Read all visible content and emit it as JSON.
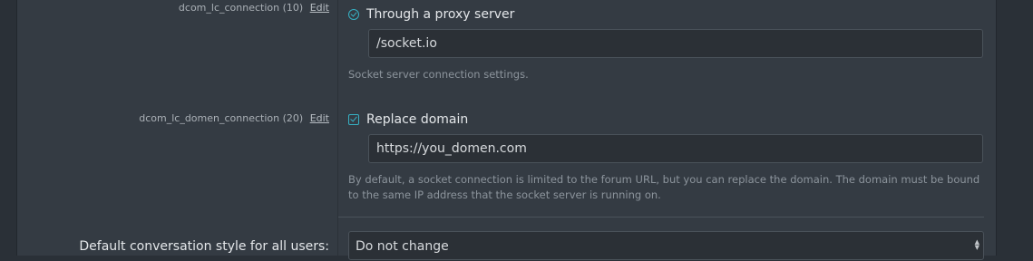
{
  "rows": [
    {
      "label": "dcom_lc_connection (10)",
      "edit": "Edit",
      "option_label": "Through a proxy server",
      "input_value": "/socket.io",
      "hint": "Socket server connection settings."
    },
    {
      "label": "dcom_lc_domen_connection (20)",
      "edit": "Edit",
      "option_label": "Replace domain",
      "input_value": "https://you_domen.com",
      "hint_line1": "By default, a socket connection is limited to the forum URL, but you can replace the domain. The domain must be bound",
      "hint_line2": "to the same IP address that the socket server is running on."
    }
  ],
  "conversation_style": {
    "label": "Default conversation style for all users:",
    "value": "Do not change"
  },
  "colors": {
    "accent": "#36b1c4",
    "panel": "#343b43",
    "input_bg": "#2b3036"
  },
  "icons": {
    "radio": "radio-checked-icon",
    "checkbox": "checkbox-checked-icon",
    "select": "select-arrows-icon"
  }
}
